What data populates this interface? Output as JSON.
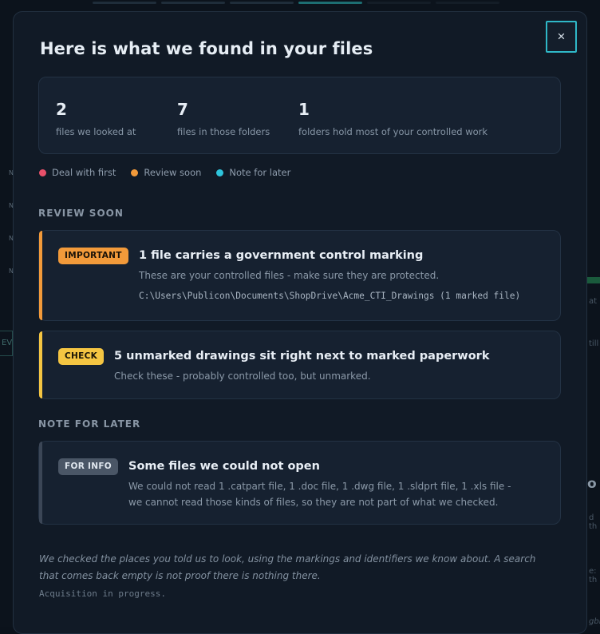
{
  "modal": {
    "title": "Here is what we found in your files",
    "close_label": "×"
  },
  "stats": [
    {
      "value": "2",
      "label": "files we looked at"
    },
    {
      "value": "7",
      "label": "files in those folders"
    },
    {
      "value": "1",
      "label": "folders hold most of your controlled work"
    }
  ],
  "legend": [
    {
      "label": "Deal with first",
      "color": "#e8506a"
    },
    {
      "label": "Review soon",
      "color": "#f29a3a"
    },
    {
      "label": "Note for later",
      "color": "#2ec4dc"
    }
  ],
  "sections": {
    "review_soon": "REVIEW SOON",
    "note_for_later": "NOTE FOR LATER"
  },
  "findings": {
    "important": {
      "badge": "IMPORTANT",
      "badge_color": "#f29a3a",
      "title": "1 file carries a government control marking",
      "desc": "These are your controlled files - make sure they are protected.",
      "path": "C:\\Users\\Publicon\\Documents\\ShopDrive\\Acme_CTI_Drawings (1 marked file)"
    },
    "check": {
      "badge": "CHECK",
      "badge_color": "#f4c542",
      "title": "5 unmarked drawings sit right next to marked paperwork",
      "desc": "Check these - probably controlled too, but unmarked."
    },
    "info": {
      "badge": "FOR INFO",
      "badge_color": "#4a5666",
      "title": "Some files we could not open",
      "desc": "We could not read 1 .catpart file, 1 .doc file, 1 .dwg file, 1 .sldprt file, 1 .xls file - we cannot read those kinds of files, so they are not part of what we checked."
    }
  },
  "footer": {
    "note": "We checked the places you told us to look, using the markings and identifiers we know about. A search that comes back empty is not proof there is nothing there.",
    "status": "Acquisition in progress."
  },
  "background": {
    "left_marks": [
      "N",
      "N",
      "N",
      "N"
    ],
    "ev_label": "EV",
    "right_texts": [
      "at",
      "till",
      "d th",
      "e: th",
      "gbr"
    ],
    "right_heading": "o"
  }
}
